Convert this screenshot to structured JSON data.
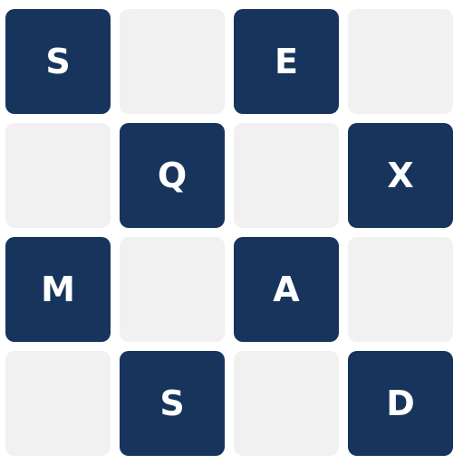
{
  "colors": {
    "filled_tile": "#17345c",
    "empty_tile": "#f1f1f1",
    "letter": "#ffffff",
    "background": "#ffffff"
  },
  "board": {
    "rows": [
      [
        "S",
        "",
        "E",
        ""
      ],
      [
        "",
        "Q",
        "",
        "X"
      ],
      [
        "M",
        "",
        "A",
        ""
      ],
      [
        "",
        "S",
        "",
        "D"
      ]
    ]
  }
}
